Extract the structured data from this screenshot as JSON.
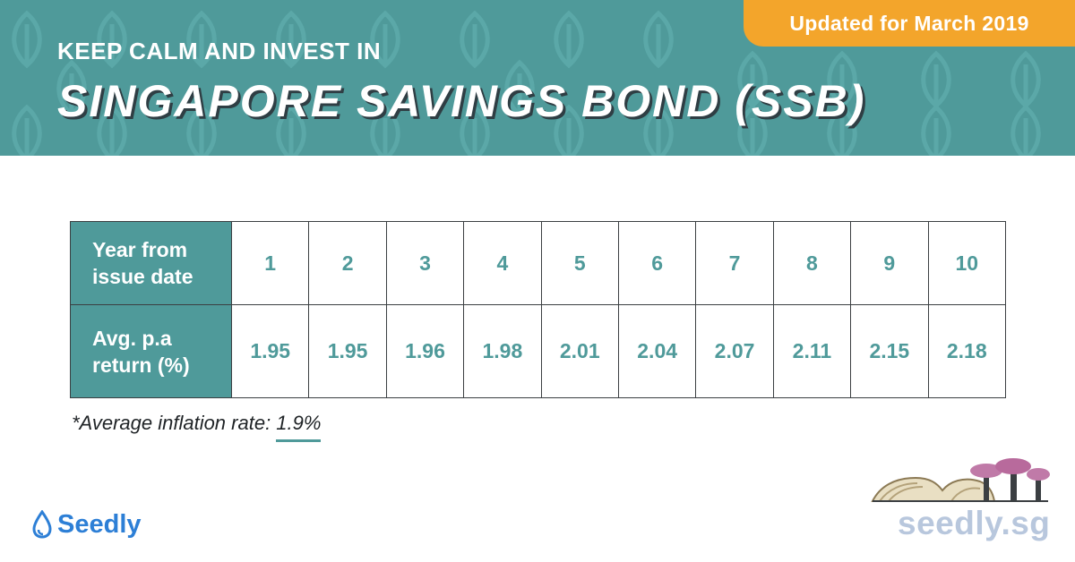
{
  "header": {
    "badge": "Updated for March 2019",
    "subtitle": "KEEP CALM AND INVEST IN",
    "title": "SINGAPORE SAVINGS BOND (SSB)"
  },
  "table": {
    "row1_label_line1": "Year from",
    "row1_label_line2": "issue date",
    "row2_label_line1": "Avg. p.a",
    "row2_label_line2": "return (%)",
    "years": [
      "1",
      "2",
      "3",
      "4",
      "5",
      "6",
      "7",
      "8",
      "9",
      "10"
    ],
    "returns": [
      "1.95",
      "1.95",
      "1.96",
      "1.98",
      "2.01",
      "2.04",
      "2.07",
      "2.11",
      "2.15",
      "2.18"
    ]
  },
  "footnote": {
    "label": "*Average inflation rate: ",
    "value": "1.9%"
  },
  "brand": {
    "logo_text": "Seedly",
    "site": "seedly.sg"
  },
  "colors": {
    "teal": "#4f9a9a",
    "orange": "#f3a52b",
    "brand_blue": "#2d7fd6",
    "site_grey": "#b8c7dd"
  },
  "icons": [
    "leaf-pattern",
    "seedly-drop-icon",
    "gardens-by-the-bay-skyline"
  ]
}
